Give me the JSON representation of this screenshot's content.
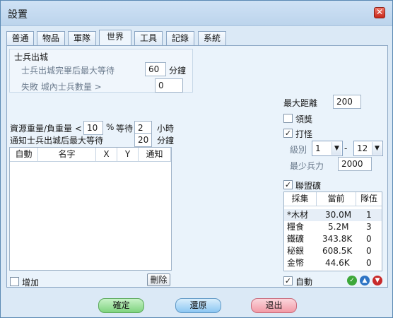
{
  "window": {
    "title": "設置",
    "close": "✕"
  },
  "tabs": [
    {
      "label": "普通"
    },
    {
      "label": "物品"
    },
    {
      "label": "軍隊"
    },
    {
      "label": "世界"
    },
    {
      "label": "工具"
    },
    {
      "label": "記錄"
    },
    {
      "label": "系統"
    }
  ],
  "active_tab": "世界",
  "troop_out": {
    "title": "士兵出城",
    "wait_label": "士兵出城完畢后最大等待",
    "wait_value": "60",
    "wait_unit": "分鐘",
    "fail_label": "失敗 城內士兵數量 >",
    "fail_value": "0"
  },
  "left": {
    "resource_label": "資源重量/負重量 <",
    "resource_value": "10",
    "percent": "%",
    "wait_label": "等待",
    "wait_value": "2",
    "hours_unit": "小時",
    "notify_label": "通知士兵出城后最大等待",
    "notify_value": "20",
    "minutes_unit": "分鐘",
    "list_headers": [
      "自動",
      "名字",
      "X",
      "Y",
      "通知"
    ],
    "add_label": "增加",
    "delete_label": "刪除"
  },
  "right": {
    "max_distance_label": "最大距離",
    "max_distance_value": "200",
    "reward_label": "領獎",
    "reward_checked": false,
    "monster_label": "打怪",
    "monster_checked": true,
    "level_label": "級別",
    "level_from": "1",
    "dash": "-",
    "level_to": "12",
    "min_troops_label": "最少兵力",
    "min_troops_value": "2000",
    "alliance_label": "聯盟礦",
    "alliance_checked": true,
    "res_headers": [
      "採集",
      "當前",
      "隊伍"
    ],
    "resources": [
      {
        "name": "*木材",
        "current": "30.0M",
        "team": "1"
      },
      {
        "name": "糧食",
        "current": "5.2M",
        "team": "3"
      },
      {
        "name": "鐵礦",
        "current": "343.8K",
        "team": "0"
      },
      {
        "name": "秘銀",
        "current": "608.5K",
        "team": "0"
      },
      {
        "name": "金幣",
        "current": "44.6K",
        "team": "0"
      }
    ],
    "auto_label": "自動",
    "auto_checked": true
  },
  "footer": {
    "confirm": "確定",
    "restore": "還原",
    "exit": "退出"
  },
  "colors": {
    "confirm": "#7ed37e",
    "restore": "#8cc6f2",
    "exit": "#f29aa6"
  }
}
